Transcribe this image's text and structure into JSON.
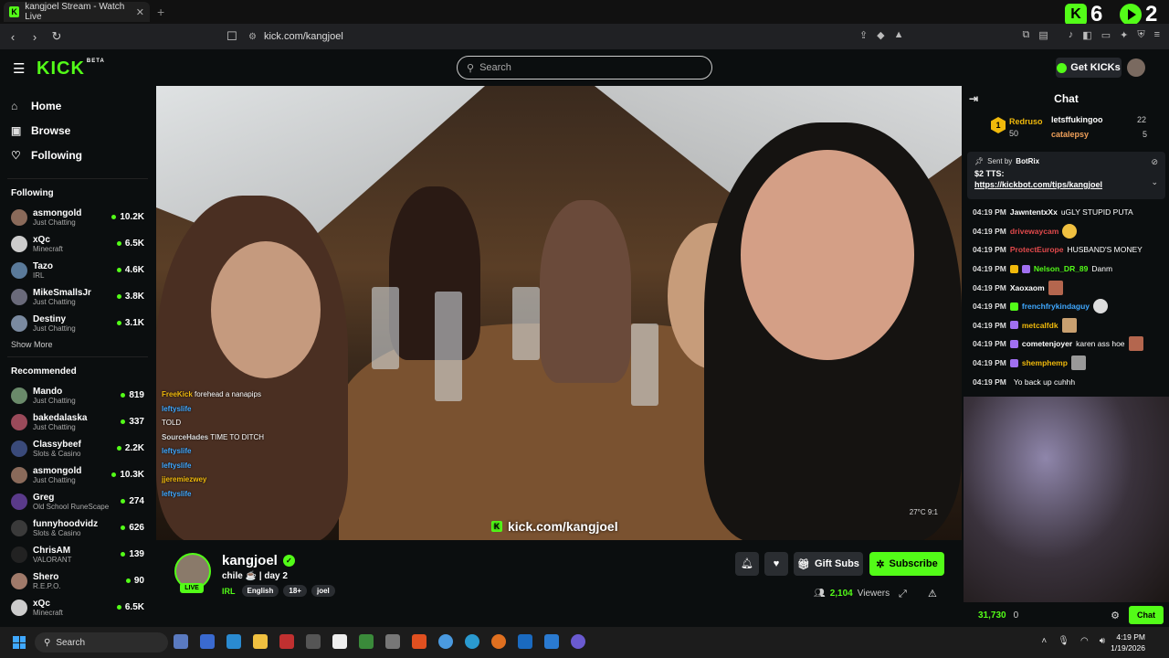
{
  "browser": {
    "tab_title": "kangjoel Stream - Watch Live",
    "url": "kick.com/kangjoel",
    "new_tab_symbol": "+",
    "overlay_counter_1": "6",
    "overlay_counter_2": "2"
  },
  "header": {
    "logo": "KICK",
    "logo_badge": "BETA",
    "search_placeholder": "Search",
    "get_kicks_label": "Get KICKs"
  },
  "sidebar": {
    "nav": [
      {
        "label": "Home",
        "icon": "home-icon"
      },
      {
        "label": "Browse",
        "icon": "browse-icon"
      },
      {
        "label": "Following",
        "icon": "heart-icon"
      }
    ],
    "following_title": "Following",
    "following": [
      {
        "name": "asmongold",
        "category": "Just Chatting",
        "viewers": "10.2K"
      },
      {
        "name": "xQc",
        "category": "Minecraft",
        "viewers": "6.5K"
      },
      {
        "name": "Tazo",
        "category": "IRL",
        "viewers": "4.6K"
      },
      {
        "name": "MikeSmallsJr",
        "category": "Just Chatting",
        "viewers": "3.8K"
      },
      {
        "name": "Destiny",
        "category": "Just Chatting",
        "viewers": "3.1K"
      }
    ],
    "show_more": "Show More",
    "recommended_title": "Recommended",
    "recommended": [
      {
        "name": "Mando",
        "category": "Just Chatting",
        "viewers": "819"
      },
      {
        "name": "bakedalaska",
        "category": "Just Chatting",
        "viewers": "337"
      },
      {
        "name": "Classybeef",
        "category": "Slots & Casino",
        "viewers": "2.2K"
      },
      {
        "name": "asmongold",
        "category": "Just Chatting",
        "viewers": "10.3K"
      },
      {
        "name": "Greg",
        "category": "Old School RuneScape",
        "viewers": "274"
      },
      {
        "name": "funnyhoodvidz",
        "category": "Slots & Casino",
        "viewers": "626"
      },
      {
        "name": "ChrisAM",
        "category": "VALORANT",
        "viewers": "139"
      },
      {
        "name": "Shero",
        "category": "R.E.P.O.",
        "viewers": "90"
      },
      {
        "name": "xQc",
        "category": "Minecraft",
        "viewers": "6.5K"
      }
    ]
  },
  "video": {
    "watermark": "kick.com/kangjoel",
    "overlay_chat": [
      {
        "user": "FreeKick",
        "text": "forehead a nanapips"
      },
      {
        "user": "leftyslife",
        "text": ""
      },
      {
        "user": "",
        "text": "TOLD"
      },
      {
        "user": "SourceHades",
        "text": "TIME TO DITCH"
      },
      {
        "user": "leftyslife",
        "text": ""
      },
      {
        "user": "leftyslife",
        "text": ""
      },
      {
        "user": "jjeremiezwey",
        "text": ""
      },
      {
        "user": "leftyslife",
        "text": ""
      }
    ],
    "overlay_time": "27°C 9:1"
  },
  "stream": {
    "name": "kangjoel",
    "live_label": "LIVE",
    "title": "chile ☕ | day 2",
    "category": "IRL",
    "tags": [
      "English",
      "18+",
      "joel"
    ],
    "gift_subs_label": "Gift Subs",
    "subscribe_label": "Subscribe",
    "viewers": "2,104",
    "viewers_label": "Viewers"
  },
  "chat": {
    "title": "Chat",
    "leaderboard": {
      "rank": "1",
      "top_user": "Redruso",
      "top_count": "50",
      "user2": "letsffukingoo",
      "user2_count": "22",
      "user3": "catalepsy",
      "user3_count": "5"
    },
    "pinned": {
      "sent_by_label": "Sent by",
      "sender": "BotRix",
      "tts_text": "$2 TTS:",
      "link": "https://kickbot.com/tips/kangjoel"
    },
    "messages": [
      {
        "time": "04:19 PM",
        "user": "JawntentxXx",
        "color": "#ffffff",
        "text": "uGLY STUPID PUTA",
        "emote": false
      },
      {
        "time": "04:19 PM",
        "user": "drivewaycam",
        "color": "#e0494b",
        "text": "",
        "emote": true
      },
      {
        "time": "04:19 PM",
        "user": "ProtectEurope",
        "color": "#e0494b",
        "text": "HUSBAND'S MONEY",
        "emote": false
      },
      {
        "time": "04:19 PM",
        "user": "Nelson_DR_89",
        "color": "#53fc18",
        "text": "Danm",
        "emote": false
      },
      {
        "time": "04:19 PM",
        "user": "Xaoxaom",
        "color": "#ffffff",
        "text": "",
        "emote": true
      },
      {
        "time": "04:19 PM",
        "user": "frenchfrykindaguy",
        "color": "#3fa8ff",
        "text": "",
        "emote": true
      },
      {
        "time": "04:19 PM",
        "user": "metcalfdk",
        "color": "#f0b90b",
        "text": "",
        "emote": true
      },
      {
        "time": "04:19 PM",
        "user": "cometenjoyer",
        "color": "#ffffff",
        "text": "karen ass hoe",
        "emote": true
      },
      {
        "time": "04:19 PM",
        "user": "shemphemp",
        "color": "#f0b90b",
        "text": "",
        "emote": true
      },
      {
        "time": "04:19 PM",
        "user": "",
        "color": "#ffffff",
        "text": "Yo back up cuhhh",
        "emote": false
      }
    ],
    "points": "31,730",
    "points2": "0",
    "chat_button": "Chat"
  },
  "taskbar": {
    "search_label": "Search",
    "time": "4:19 PM",
    "date": "1/19/2026"
  }
}
